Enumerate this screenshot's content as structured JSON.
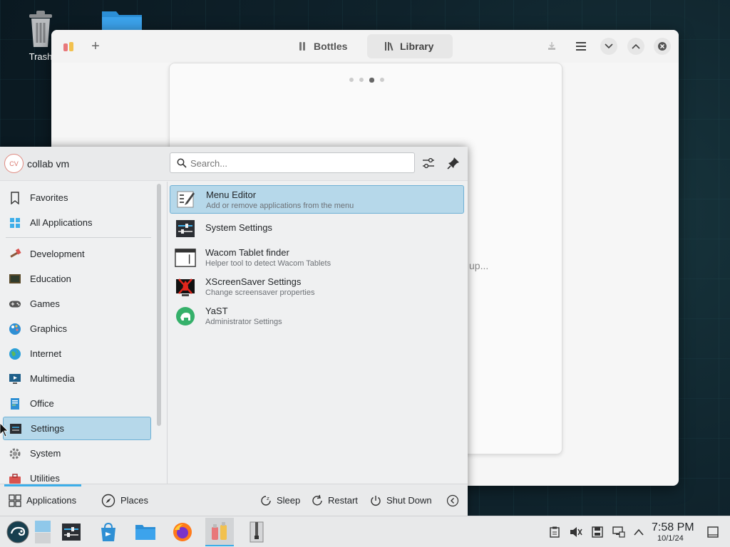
{
  "desktop": {
    "icons": [
      {
        "label": "Trash",
        "icon": "trash-icon"
      },
      {
        "label": "",
        "icon": "folder-icon"
      }
    ]
  },
  "bottles": {
    "tabs": [
      {
        "label": "Bottles",
        "icon": "bottles-icon"
      },
      {
        "label": "Library",
        "icon": "library-icon"
      }
    ],
    "welcome_status": "up..."
  },
  "launcher": {
    "user": {
      "initials": "CV",
      "name": "collab vm"
    },
    "search": {
      "placeholder": "Search..."
    },
    "categories": [
      {
        "label": "Favorites",
        "icon": "bookmark-icon"
      },
      {
        "label": "All Applications",
        "icon": "grid-icon"
      },
      {
        "label": "Development",
        "icon": "hammer-icon"
      },
      {
        "label": "Education",
        "icon": "blackboard-icon"
      },
      {
        "label": "Games",
        "icon": "gamepad-icon"
      },
      {
        "label": "Graphics",
        "icon": "palette-icon"
      },
      {
        "label": "Internet",
        "icon": "globe-icon"
      },
      {
        "label": "Multimedia",
        "icon": "monitor-play-icon"
      },
      {
        "label": "Office",
        "icon": "document-icon"
      },
      {
        "label": "Settings",
        "icon": "settings-panel-icon",
        "active": true
      },
      {
        "label": "System",
        "icon": "cog-icon"
      },
      {
        "label": "Utilities",
        "icon": "toolbox-icon"
      }
    ],
    "apps": [
      {
        "title": "Menu Editor",
        "subtitle": "Add or remove applications from the menu",
        "icon": "menu-editor-icon",
        "active": true
      },
      {
        "title": "System Settings",
        "subtitle": "",
        "icon": "system-settings-icon"
      },
      {
        "title": "Wacom Tablet finder",
        "subtitle": "Helper tool to detect Wacom Tablets",
        "icon": "wacom-icon"
      },
      {
        "title": "XScreenSaver Settings",
        "subtitle": "Change screensaver properties",
        "icon": "xscreensaver-icon"
      },
      {
        "title": "YaST",
        "subtitle": "Administrator Settings",
        "icon": "yast-icon"
      }
    ],
    "bottom_tabs": [
      {
        "label": "Applications",
        "icon": "grid-icon"
      },
      {
        "label": "Places",
        "icon": "compass-icon"
      }
    ],
    "power": [
      {
        "label": "Sleep",
        "icon": "sleep-icon"
      },
      {
        "label": "Restart",
        "icon": "restart-icon"
      },
      {
        "label": "Shut Down",
        "icon": "power-icon"
      }
    ]
  },
  "taskbar": {
    "clock": {
      "time": "7:58 PM",
      "date": "10/1/24"
    }
  },
  "colors": {
    "accent": "#3daee9",
    "highlight": "#b6d8ea",
    "panel": "#eff0f1"
  }
}
